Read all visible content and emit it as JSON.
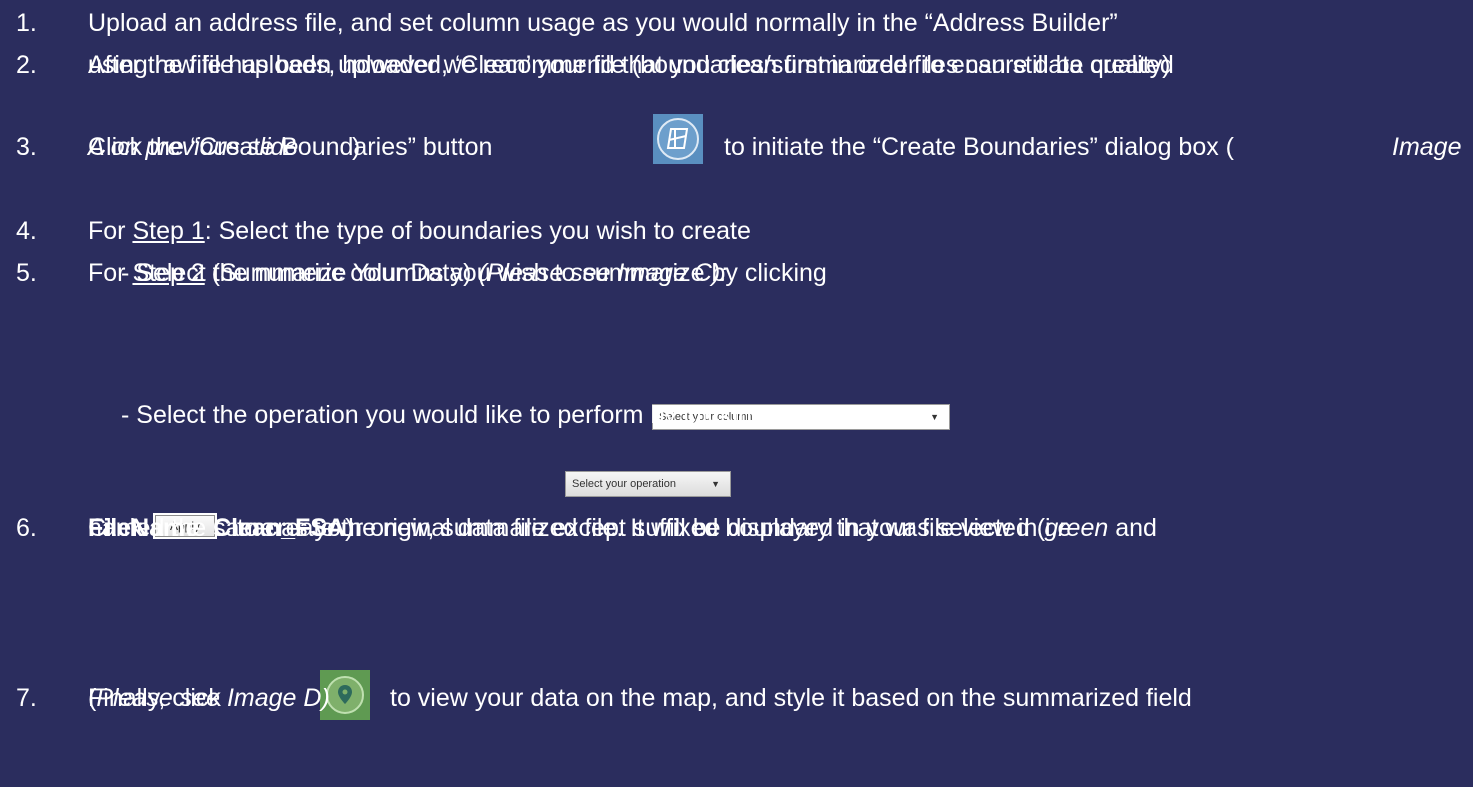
{
  "steps": [
    {
      "num": "1.",
      "lines": [
        "Upload an address file, and set column usage as you would normally in the “Address Builder”"
      ]
    },
    {
      "num": "2.",
      "lines": [
        "After the file has been uploaded, ‘Clean’ your file (boundaries/summarized files can still be created",
        "using raw file uploads, however we recommend that you clean first in order to ensure data quality)"
      ]
    },
    {
      "num": "3.",
      "pre": "Click the “Create Boundaries” button",
      "post": "to initiate the “Create Boundaries” dialog box (",
      "post_italic": "Image",
      "line2_italic": "A on previous slide",
      "line2_end": ")"
    },
    {
      "num": "4.",
      "pre": "For ",
      "link": "Step 1",
      "post": ": Select the type of boundaries you wish to create"
    },
    {
      "num": "5.",
      "pre": "For ",
      "link": "Step 2",
      "post": " (Summarize Your Data) ",
      "italic": "(Please see Image C):",
      "subs": [
        "-  Select the numeric columns you wish to summarize by clicking",
        "-  Select the operation you would like to perform by clicking"
      ]
    },
    {
      "num": "6.",
      "pre": "Click",
      "post": "to create the new, summarized file.  It will be displayed in your file view in ",
      "italic": "green",
      "post2": " and",
      "line2": "named the same as your original data file except suffixed boundary that was selected (i.e",
      "bold": "FileName_Clean_FSA",
      "line3_end": ")"
    },
    {
      "num": "7.",
      "pre": "Finally, click",
      "post": "to view your data on the map, and style it based on the summarized field",
      "line2_pre": "(",
      "line2_italic": "Please see Image D)"
    }
  ],
  "widgets": {
    "select_column_label": "Select your column",
    "select_operation_label": "Select your operation",
    "dropdown_arrow": "▼",
    "apply_label": "Apply"
  },
  "colors": {
    "background": "#2b2d5e",
    "text": "#ffffff",
    "boundaries_button": "#5a8fc0",
    "map_button": "#4a7c55"
  }
}
